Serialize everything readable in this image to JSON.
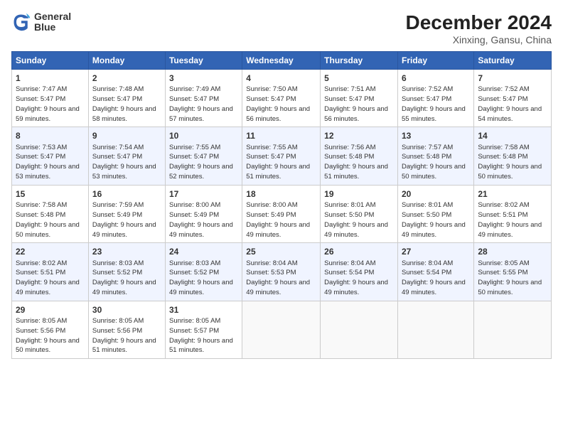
{
  "header": {
    "logo_line1": "General",
    "logo_line2": "Blue",
    "month": "December 2024",
    "location": "Xinxing, Gansu, China"
  },
  "weekdays": [
    "Sunday",
    "Monday",
    "Tuesday",
    "Wednesday",
    "Thursday",
    "Friday",
    "Saturday"
  ],
  "weeks": [
    [
      {
        "day": "1",
        "sunrise": "7:47 AM",
        "sunset": "5:47 PM",
        "daylight": "9 hours and 59 minutes."
      },
      {
        "day": "2",
        "sunrise": "7:48 AM",
        "sunset": "5:47 PM",
        "daylight": "9 hours and 58 minutes."
      },
      {
        "day": "3",
        "sunrise": "7:49 AM",
        "sunset": "5:47 PM",
        "daylight": "9 hours and 57 minutes."
      },
      {
        "day": "4",
        "sunrise": "7:50 AM",
        "sunset": "5:47 PM",
        "daylight": "9 hours and 56 minutes."
      },
      {
        "day": "5",
        "sunrise": "7:51 AM",
        "sunset": "5:47 PM",
        "daylight": "9 hours and 56 minutes."
      },
      {
        "day": "6",
        "sunrise": "7:52 AM",
        "sunset": "5:47 PM",
        "daylight": "9 hours and 55 minutes."
      },
      {
        "day": "7",
        "sunrise": "7:52 AM",
        "sunset": "5:47 PM",
        "daylight": "9 hours and 54 minutes."
      }
    ],
    [
      {
        "day": "8",
        "sunrise": "7:53 AM",
        "sunset": "5:47 PM",
        "daylight": "9 hours and 53 minutes."
      },
      {
        "day": "9",
        "sunrise": "7:54 AM",
        "sunset": "5:47 PM",
        "daylight": "9 hours and 53 minutes."
      },
      {
        "day": "10",
        "sunrise": "7:55 AM",
        "sunset": "5:47 PM",
        "daylight": "9 hours and 52 minutes."
      },
      {
        "day": "11",
        "sunrise": "7:55 AM",
        "sunset": "5:47 PM",
        "daylight": "9 hours and 51 minutes."
      },
      {
        "day": "12",
        "sunrise": "7:56 AM",
        "sunset": "5:48 PM",
        "daylight": "9 hours and 51 minutes."
      },
      {
        "day": "13",
        "sunrise": "7:57 AM",
        "sunset": "5:48 PM",
        "daylight": "9 hours and 50 minutes."
      },
      {
        "day": "14",
        "sunrise": "7:58 AM",
        "sunset": "5:48 PM",
        "daylight": "9 hours and 50 minutes."
      }
    ],
    [
      {
        "day": "15",
        "sunrise": "7:58 AM",
        "sunset": "5:48 PM",
        "daylight": "9 hours and 50 minutes."
      },
      {
        "day": "16",
        "sunrise": "7:59 AM",
        "sunset": "5:49 PM",
        "daylight": "9 hours and 49 minutes."
      },
      {
        "day": "17",
        "sunrise": "8:00 AM",
        "sunset": "5:49 PM",
        "daylight": "9 hours and 49 minutes."
      },
      {
        "day": "18",
        "sunrise": "8:00 AM",
        "sunset": "5:49 PM",
        "daylight": "9 hours and 49 minutes."
      },
      {
        "day": "19",
        "sunrise": "8:01 AM",
        "sunset": "5:50 PM",
        "daylight": "9 hours and 49 minutes."
      },
      {
        "day": "20",
        "sunrise": "8:01 AM",
        "sunset": "5:50 PM",
        "daylight": "9 hours and 49 minutes."
      },
      {
        "day": "21",
        "sunrise": "8:02 AM",
        "sunset": "5:51 PM",
        "daylight": "9 hours and 49 minutes."
      }
    ],
    [
      {
        "day": "22",
        "sunrise": "8:02 AM",
        "sunset": "5:51 PM",
        "daylight": "9 hours and 49 minutes."
      },
      {
        "day": "23",
        "sunrise": "8:03 AM",
        "sunset": "5:52 PM",
        "daylight": "9 hours and 49 minutes."
      },
      {
        "day": "24",
        "sunrise": "8:03 AM",
        "sunset": "5:52 PM",
        "daylight": "9 hours and 49 minutes."
      },
      {
        "day": "25",
        "sunrise": "8:04 AM",
        "sunset": "5:53 PM",
        "daylight": "9 hours and 49 minutes."
      },
      {
        "day": "26",
        "sunrise": "8:04 AM",
        "sunset": "5:54 PM",
        "daylight": "9 hours and 49 minutes."
      },
      {
        "day": "27",
        "sunrise": "8:04 AM",
        "sunset": "5:54 PM",
        "daylight": "9 hours and 49 minutes."
      },
      {
        "day": "28",
        "sunrise": "8:05 AM",
        "sunset": "5:55 PM",
        "daylight": "9 hours and 50 minutes."
      }
    ],
    [
      {
        "day": "29",
        "sunrise": "8:05 AM",
        "sunset": "5:56 PM",
        "daylight": "9 hours and 50 minutes."
      },
      {
        "day": "30",
        "sunrise": "8:05 AM",
        "sunset": "5:56 PM",
        "daylight": "9 hours and 51 minutes."
      },
      {
        "day": "31",
        "sunrise": "8:05 AM",
        "sunset": "5:57 PM",
        "daylight": "9 hours and 51 minutes."
      },
      null,
      null,
      null,
      null
    ]
  ]
}
